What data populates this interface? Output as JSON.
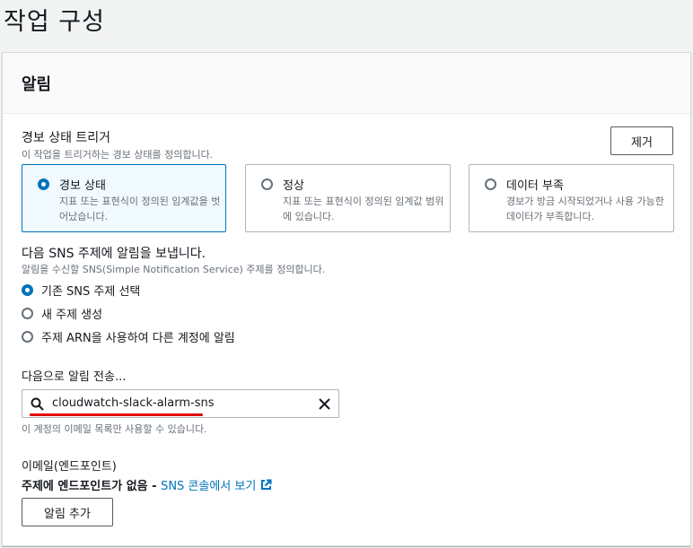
{
  "page": {
    "title": "작업 구성"
  },
  "panel": {
    "title": "알림",
    "alarm_state": {
      "label": "경보 상태 트리거",
      "description": "이 작업을 트리거하는 경보 상태를 정의합니다.",
      "remove_label": "제거",
      "options": [
        {
          "title": "경보 상태",
          "description": "지표 또는 표현식이 정의된 임계값을 벗어났습니다.",
          "selected": true
        },
        {
          "title": "정상",
          "description": "지표 또는 표현식이 정의된 임계값 범위에 있습니다.",
          "selected": false
        },
        {
          "title": "데이터 부족",
          "description": "경보가 방금 시작되었거나 사용 가능한 데이터가 부족합니다.",
          "selected": false
        }
      ]
    },
    "sns": {
      "label": "다음 SNS 주제에 알림을 보냅니다.",
      "description": "알림을 수신할 SNS(Simple Notification Service) 주제를 정의합니다.",
      "options": [
        {
          "label": "기존 SNS 주제 선택",
          "selected": true
        },
        {
          "label": "새 주제 생성",
          "selected": false
        },
        {
          "label": "주제 ARN을 사용하여 다른 계정에 알림",
          "selected": false
        }
      ]
    },
    "send_to": {
      "label": "다음으로 알림 전송...",
      "value": "cloudwatch-slack-alarm-sns",
      "hint": "이 계정의 이메일 목록만 사용할 수 있습니다."
    },
    "email": {
      "label": "이메일(엔드포인트)",
      "no_endpoint_text": "주제에 엔드포인트가 없음 - ",
      "sns_console_link": "SNS 콘솔에서 보기"
    },
    "add_notification_label": "알림 추가"
  },
  "colors": {
    "accent": "#0073bb",
    "annotation": "#e00000"
  }
}
